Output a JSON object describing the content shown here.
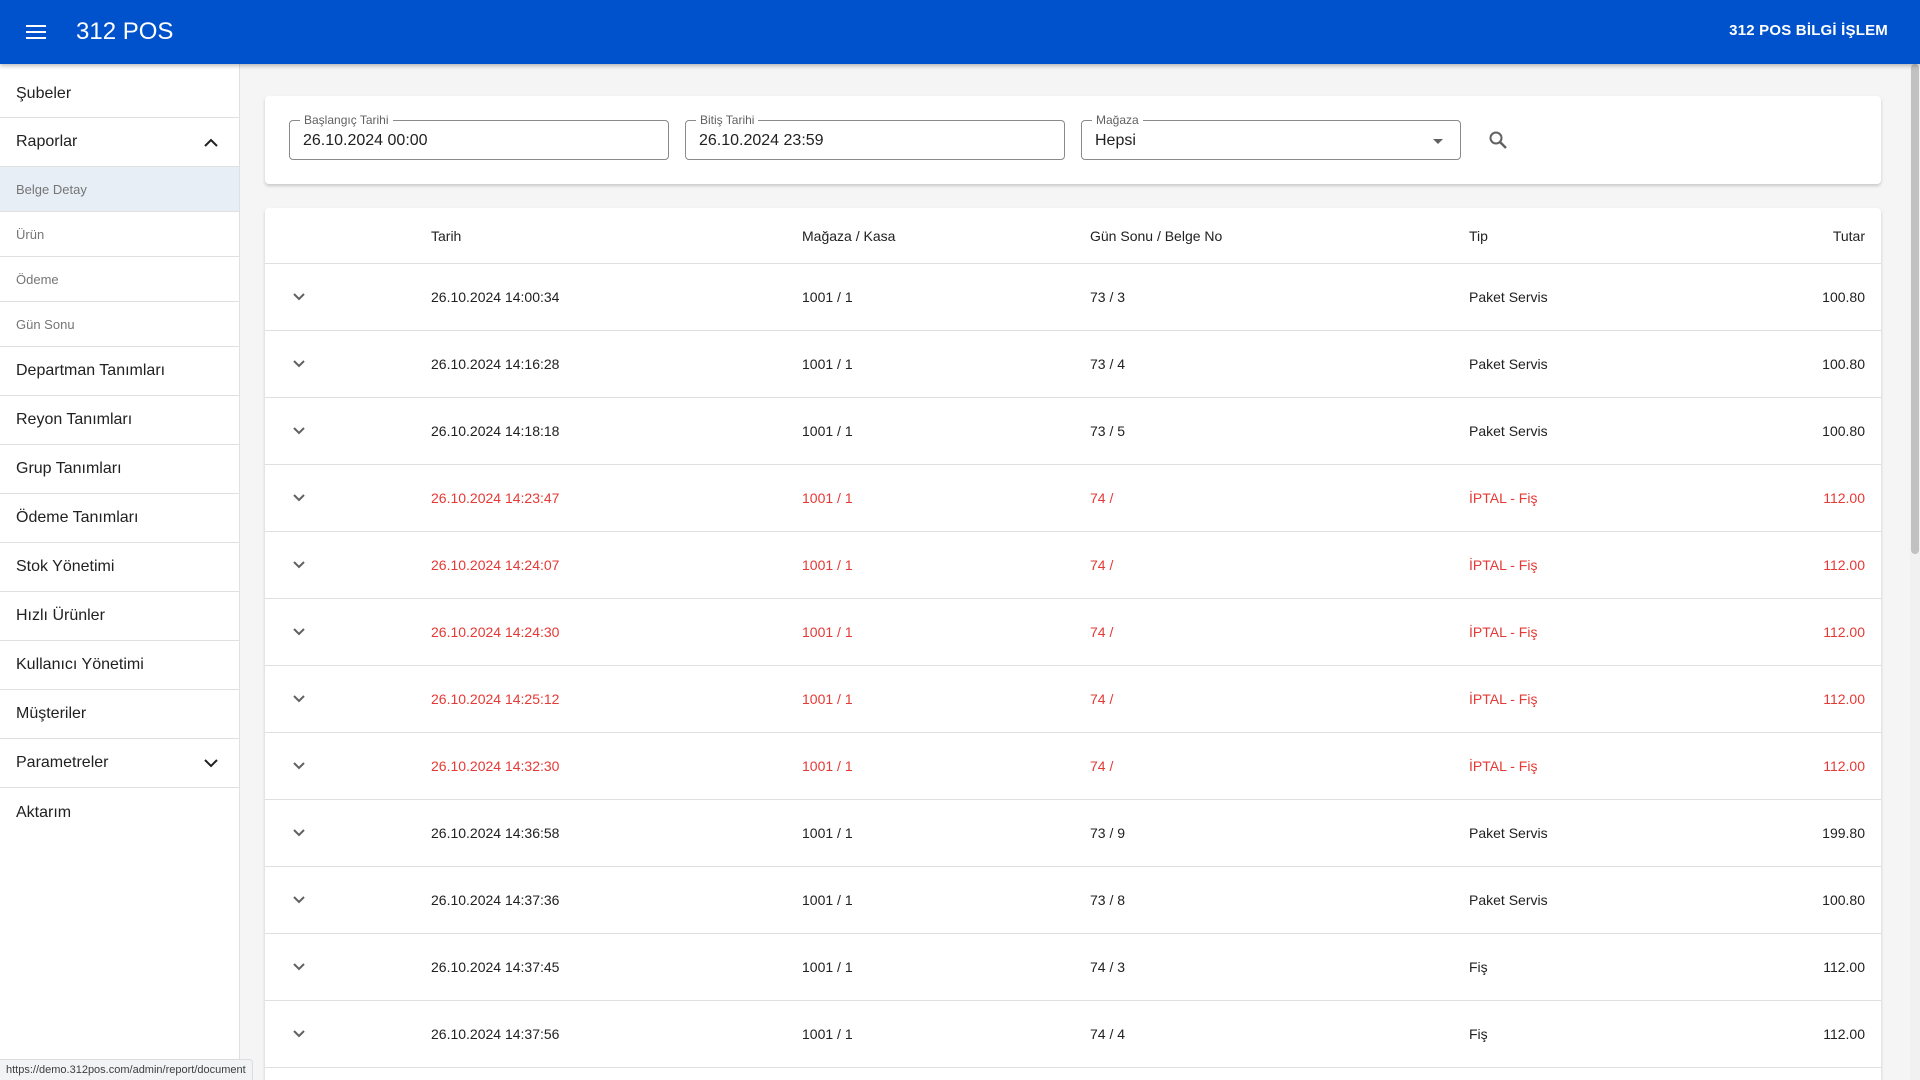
{
  "appbar": {
    "title": "312 POS",
    "user_label": "312 POS BİLGİ İŞLEM",
    "menu_icon": "menu-icon"
  },
  "sidebar": {
    "items": [
      {
        "label": "Şubeler"
      },
      {
        "label": "Raporlar",
        "expanded": true,
        "icon": "chevron-up-icon",
        "children": [
          {
            "label": "Belge Detay",
            "active": true
          },
          {
            "label": "Ürün"
          },
          {
            "label": "Ödeme"
          },
          {
            "label": "Gün Sonu"
          }
        ]
      },
      {
        "label": "Departman Tanımları"
      },
      {
        "label": "Reyon Tanımları"
      },
      {
        "label": "Grup Tanımları"
      },
      {
        "label": "Ödeme Tanımları"
      },
      {
        "label": "Stok Yönetimi"
      },
      {
        "label": "Hızlı Ürünler"
      },
      {
        "label": "Kullanıcı Yönetimi"
      },
      {
        "label": "Müşteriler"
      },
      {
        "label": "Parametreler",
        "expanded": false,
        "icon": "chevron-down-icon"
      },
      {
        "label": "Aktarım"
      }
    ]
  },
  "filters": {
    "start_date": {
      "label": "Başlangıç Tarihi",
      "value": "26.10.2024 00:00"
    },
    "end_date": {
      "label": "Bitiş Tarihi",
      "value": "26.10.2024 23:59"
    },
    "store": {
      "label": "Mağaza",
      "value": "Hepsi"
    },
    "search_icon": "search-icon"
  },
  "table": {
    "columns": {
      "date": "Tarih",
      "store": "Mağaza / Kasa",
      "doc": "Gün Sonu / Belge No",
      "type": "Tip",
      "amount": "Tutar"
    },
    "rows": [
      {
        "date": "26.10.2024 14:00:34",
        "store": "1001 / 1",
        "doc": "73 / 3",
        "type": "Paket Servis",
        "amount": "100.80",
        "cancelled": false
      },
      {
        "date": "26.10.2024 14:16:28",
        "store": "1001 / 1",
        "doc": "73 / 4",
        "type": "Paket Servis",
        "amount": "100.80",
        "cancelled": false
      },
      {
        "date": "26.10.2024 14:18:18",
        "store": "1001 / 1",
        "doc": "73 / 5",
        "type": "Paket Servis",
        "amount": "100.80",
        "cancelled": false
      },
      {
        "date": "26.10.2024 14:23:47",
        "store": "1001 / 1",
        "doc": "74 /",
        "type": "İPTAL - Fiş",
        "amount": "112.00",
        "cancelled": true
      },
      {
        "date": "26.10.2024 14:24:07",
        "store": "1001 / 1",
        "doc": "74 /",
        "type": "İPTAL - Fiş",
        "amount": "112.00",
        "cancelled": true
      },
      {
        "date": "26.10.2024 14:24:30",
        "store": "1001 / 1",
        "doc": "74 /",
        "type": "İPTAL - Fiş",
        "amount": "112.00",
        "cancelled": true
      },
      {
        "date": "26.10.2024 14:25:12",
        "store": "1001 / 1",
        "doc": "74 /",
        "type": "İPTAL - Fiş",
        "amount": "112.00",
        "cancelled": true
      },
      {
        "date": "26.10.2024 14:32:30",
        "store": "1001 / 1",
        "doc": "74 /",
        "type": "İPTAL - Fiş",
        "amount": "112.00",
        "cancelled": true
      },
      {
        "date": "26.10.2024 14:36:58",
        "store": "1001 / 1",
        "doc": "73 / 9",
        "type": "Paket Servis",
        "amount": "199.80",
        "cancelled": false
      },
      {
        "date": "26.10.2024 14:37:36",
        "store": "1001 / 1",
        "doc": "73 / 8",
        "type": "Paket Servis",
        "amount": "100.80",
        "cancelled": false
      },
      {
        "date": "26.10.2024 14:37:45",
        "store": "1001 / 1",
        "doc": "74 / 3",
        "type": "Fiş",
        "amount": "112.00",
        "cancelled": false
      },
      {
        "date": "26.10.2024 14:37:56",
        "store": "1001 / 1",
        "doc": "74 / 4",
        "type": "Fiş",
        "amount": "112.00",
        "cancelled": false
      }
    ]
  },
  "status_bar": {
    "url": "https://demo.312pos.com/admin/report/document"
  },
  "colors": {
    "primary": "#0052cc",
    "cancelled": "#e53935",
    "active_bg": "#e8eef6"
  }
}
